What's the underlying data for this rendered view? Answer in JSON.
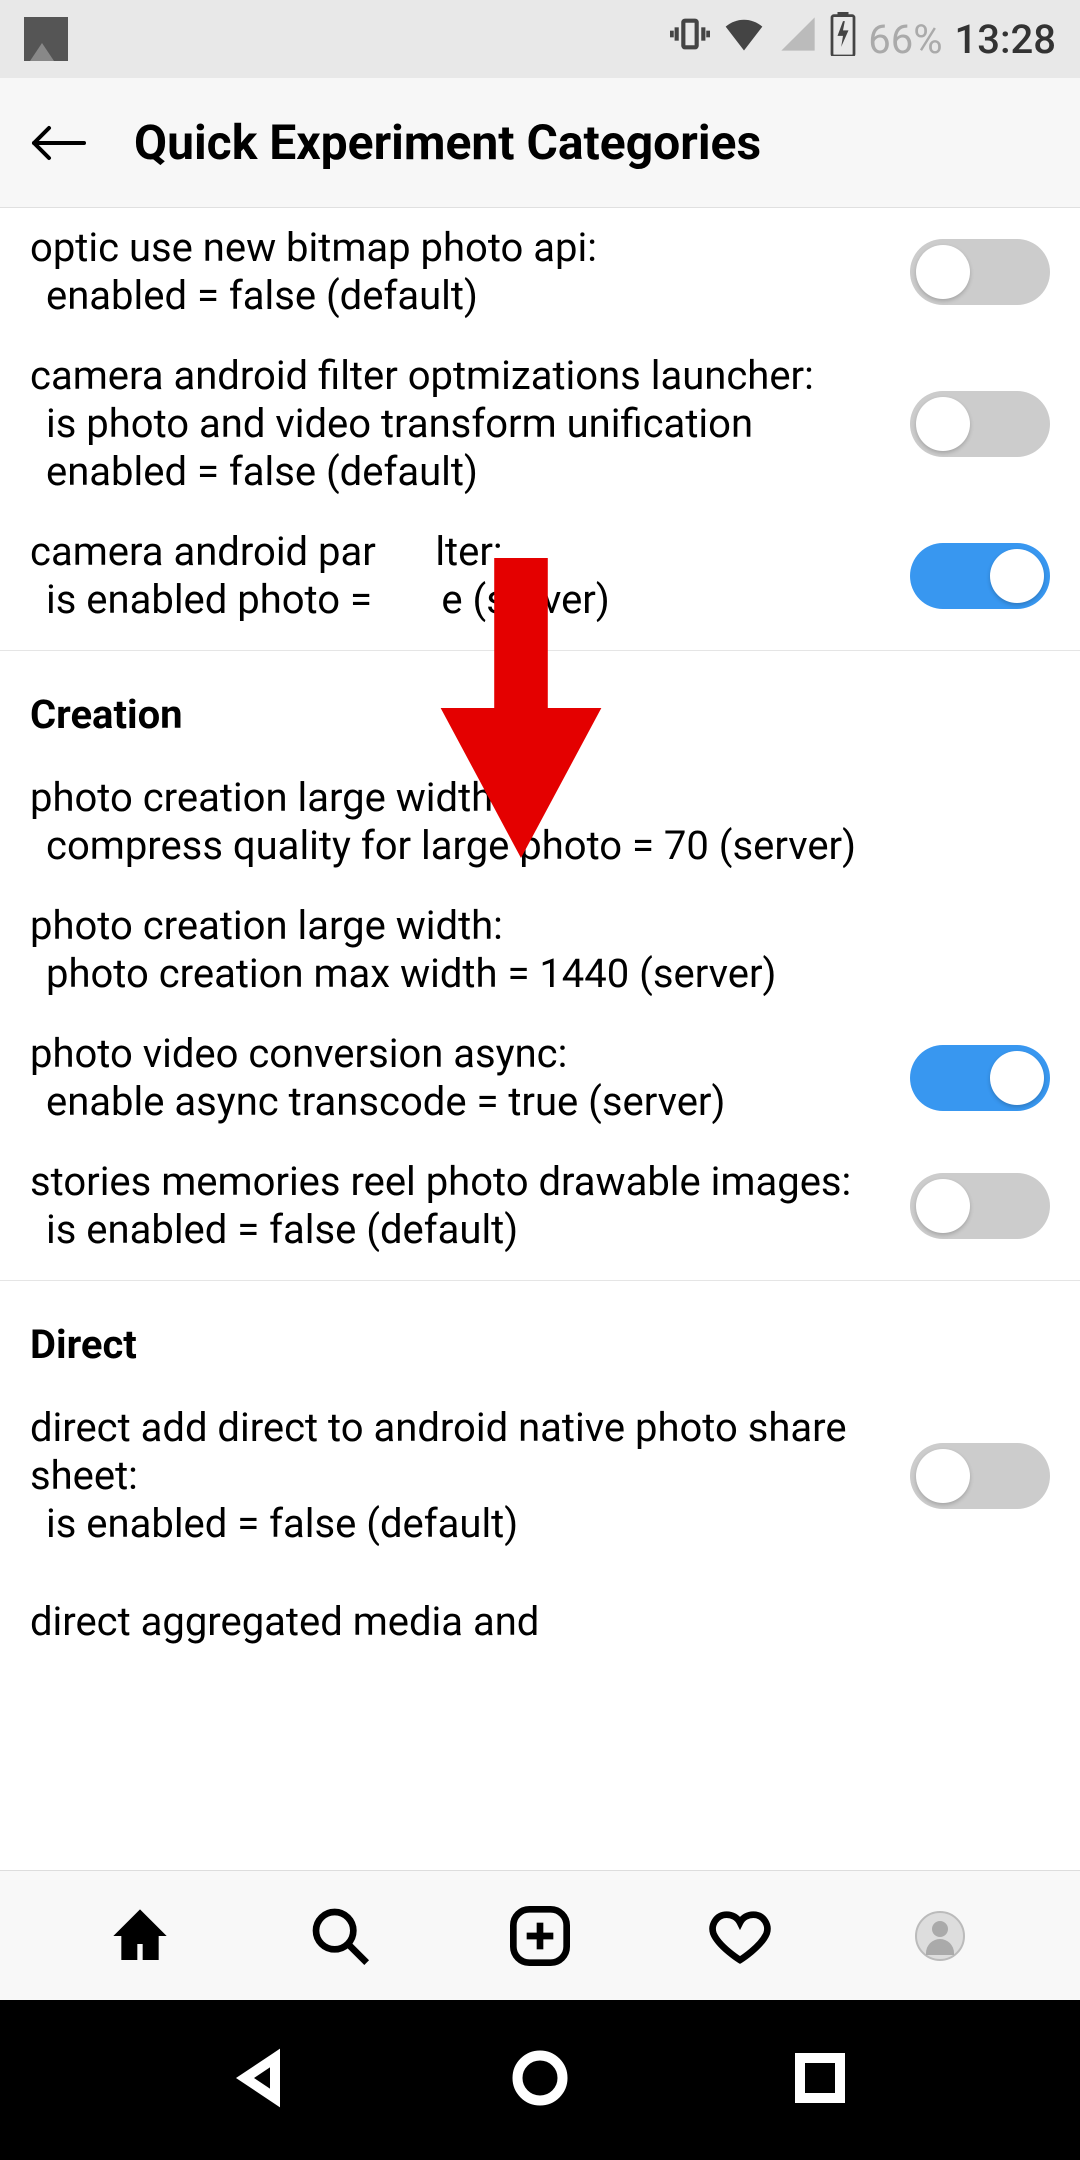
{
  "status": {
    "battery": "66%",
    "time": "13:28"
  },
  "header": {
    "title": "Quick Experiment Categories"
  },
  "sections": [
    {
      "items": [
        {
          "title": "optic use new bitmap photo api:",
          "sub": "enabled = false (default)",
          "toggle": false
        },
        {
          "title": "camera android filter optmizations launcher:",
          "sub": "is photo and video transform unification enabled = false (default)",
          "toggle": false
        },
        {
          "title": "camera android par      lter:",
          "sub": "is enabled photo =       e (server)",
          "toggle": true
        }
      ]
    },
    {
      "header": "Creation",
      "items": [
        {
          "title": "photo creation large width:",
          "sub": "compress quality for large photo = 70 (server)",
          "toggle": null
        },
        {
          "title": "photo creation large width:",
          "sub": "photo creation max width = 1440 (server)",
          "toggle": null
        },
        {
          "title": "photo video conversion async:",
          "sub": "enable async transcode = true (server)",
          "toggle": true
        },
        {
          "title": "stories memories reel photo drawable images:",
          "sub": "is enabled = false (default)",
          "toggle": false
        }
      ]
    },
    {
      "header": "Direct",
      "items": [
        {
          "title": "direct add direct to android native photo share sheet:",
          "sub": "is enabled = false (default)",
          "toggle": false
        },
        {
          "title": "direct aggregated media and",
          "sub": "",
          "toggle": null
        }
      ]
    }
  ],
  "colors": {
    "accent": "#3897f0",
    "arrow": "#e40000"
  }
}
